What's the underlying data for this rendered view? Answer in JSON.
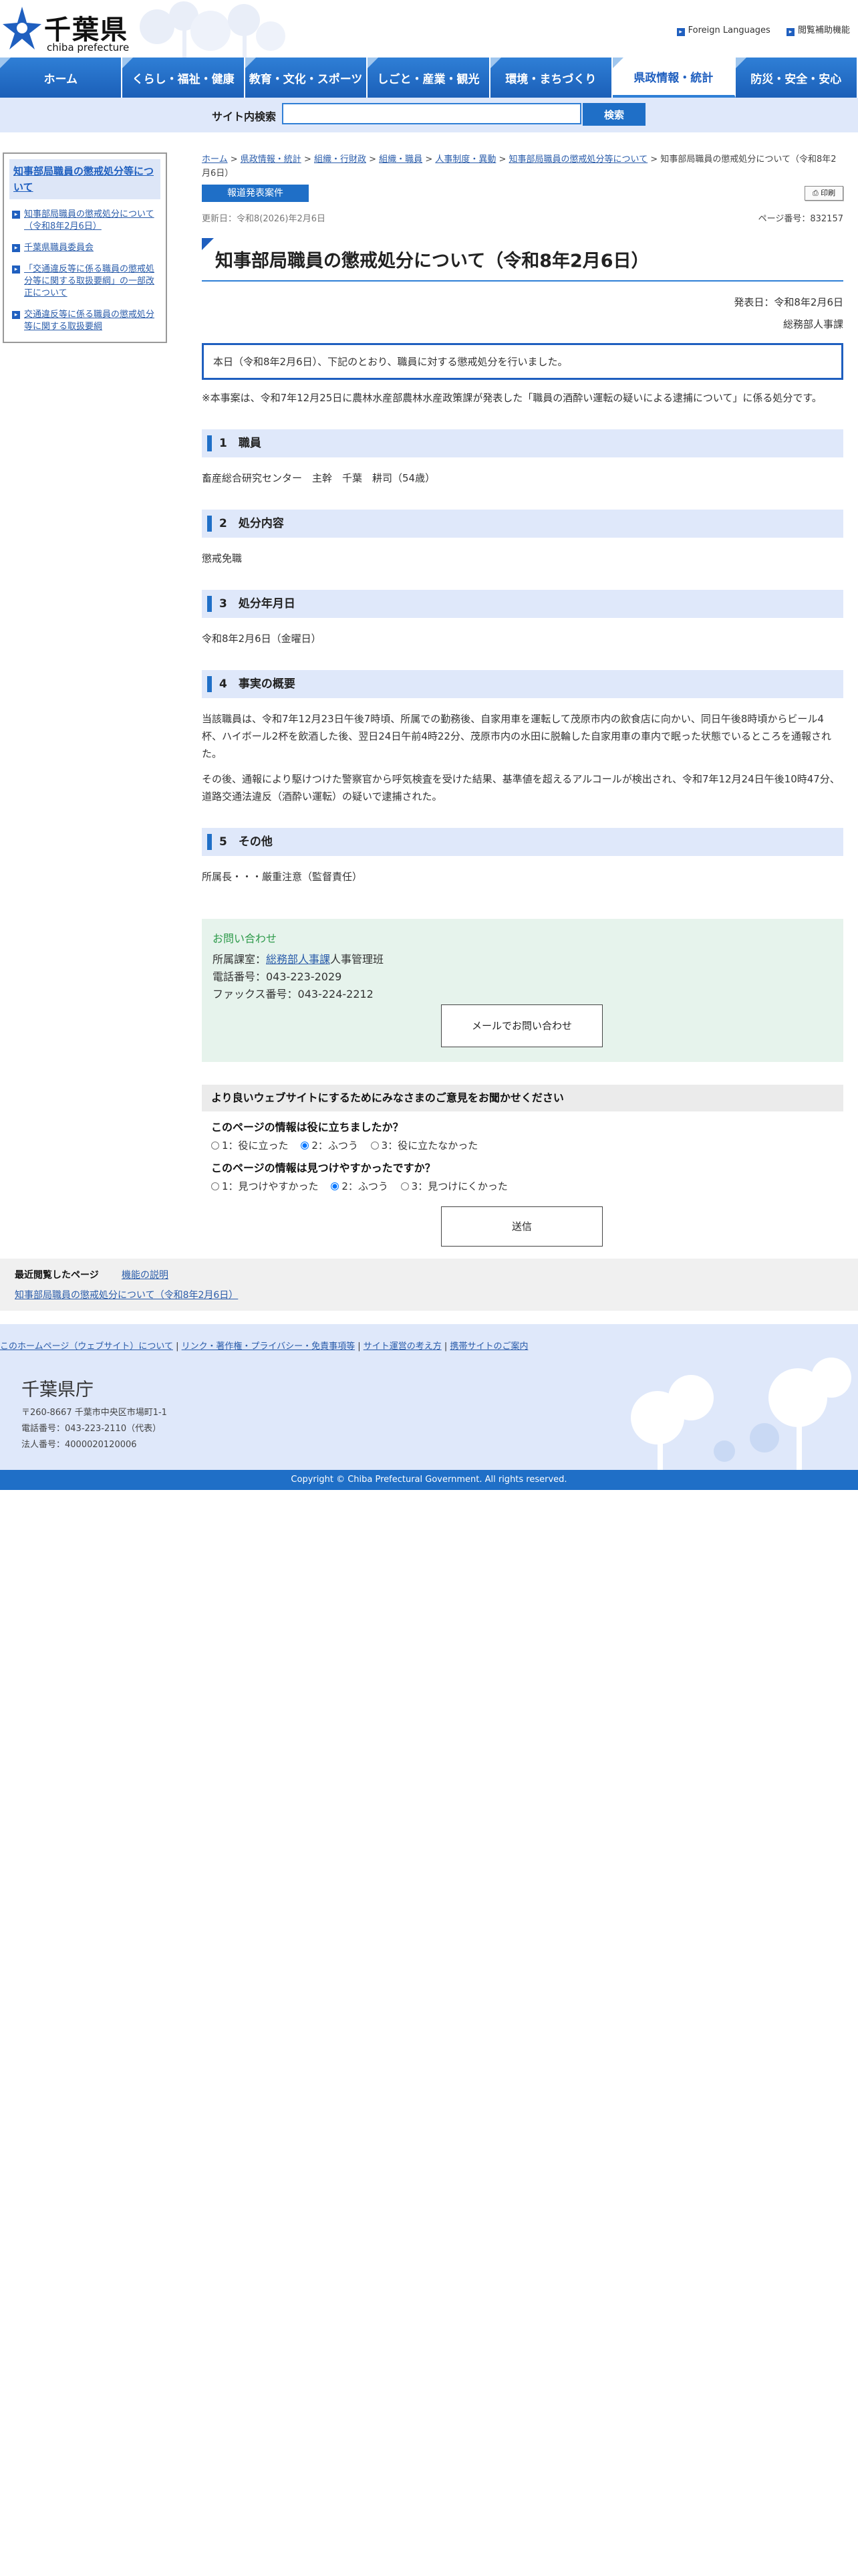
{
  "header": {
    "logo_jp": "千葉県",
    "logo_en": "chiba prefecture",
    "links": [
      "Foreign Languages",
      "閲覧補助機能"
    ]
  },
  "gnav": [
    "ホーム",
    "くらし・福祉・健康",
    "教育・文化・スポーツ",
    "しごと・産業・観光",
    "環境・まちづくり",
    "県政情報・統計",
    "防災・安全・安心"
  ],
  "search": {
    "label": "サイト内検索",
    "button": "検索",
    "placeholder": ""
  },
  "sidebar": {
    "title": "知事部局職員の懲戒処分等について",
    "links": [
      "知事部局職員の懲戒処分について（令和8年2月6日）",
      "千葉県職員委員会",
      "「交通違反等に係る職員の懲戒処分等に関する取扱要綱」の一部改正について",
      "交通違反等に係る職員の懲戒処分等に関する取扱要綱"
    ]
  },
  "breadcrumb": {
    "items": [
      "ホーム",
      "県政情報・統計",
      "組織・行財政",
      "組織・職員",
      "人事制度・異動",
      "知事部局職員の懲戒処分等について"
    ],
    "current": "知事部局職員の懲戒処分について（令和8年2月6日）"
  },
  "badge": "報道発表案件",
  "print": "印刷",
  "updated": "更新日：令和8(2026)年2月6日",
  "page_no": "ページ番号：832157",
  "title": "知事部局職員の懲戒処分について（令和8年2月6日）",
  "pub_date": "発表日：令和8年2月6日",
  "department": "総務部人事課",
  "announce": "本日（令和8年2月6日）、下記のとおり、職員に対する懲戒処分を行いました。",
  "note": "※本事案は、令和7年12月25日に農林水産部農林水産政策課が発表した「職員の酒酔い運転の疑いによる逮捕について」に係る処分です。",
  "sections": [
    {
      "heading": "1　職員",
      "body": [
        "畜産総合研究センター　主幹　千葉　耕司（54歳）"
      ]
    },
    {
      "heading": "2　処分内容",
      "body": [
        "懲戒免職"
      ]
    },
    {
      "heading": "3　処分年月日",
      "body": [
        "令和8年2月6日（金曜日）"
      ]
    },
    {
      "heading": "4　事実の概要",
      "body": [
        "当該職員は、令和7年12月23日午後7時頃、所属での勤務後、自家用車を運転して茂原市内の飲食店に向かい、同日午後8時頃からビール4杯、ハイボール2杯を飲酒した後、翌日24日午前4時22分、茂原市内の水田に脱輪した自家用車の車内で眠った状態でいるところを通報された。",
        "その後、通報により駆けつけた警察官から呼気検査を受けた結果、基準値を超えるアルコールが検出され、令和7年12月24日午後10時47分、道路交通法違反（酒酔い運転）の疑いで逮捕された。"
      ]
    },
    {
      "heading": "5　その他",
      "body": [
        "所属長・・・厳重注意（監督責任）"
      ]
    }
  ],
  "contact": {
    "title": "お問い合わせ",
    "dept_prefix": "所属課室：",
    "dept_link": "総務部人事課",
    "dept_suffix": "人事管理班",
    "tel": "電話番号：043-223-2029",
    "fax": "ファックス番号：043-224-2212",
    "mail_button": "メールでお問い合わせ"
  },
  "feedback": {
    "title": "より良いウェブサイトにするためにみなさまのご意見をお聞かせください",
    "q1": "このページの情報は役に立ちましたか？",
    "q1_options": [
      "1：役に立った",
      "2：ふつう",
      "3：役に立たなかった"
    ],
    "q2": "このページの情報は見つけやすかったですか？",
    "q2_options": [
      "1：見つけやすかった",
      "2：ふつう",
      "3：見つけにくかった"
    ],
    "selected": "2",
    "send": "送信"
  },
  "recent": {
    "label": "最近閲覧したページ",
    "help": "機能の説明",
    "item": "知事部局職員の懲戒処分について（令和8年2月6日）"
  },
  "footer": {
    "links": [
      "このホームページ（ウェブサイト）について",
      "リンク・著作権・プライバシー・免責事項等",
      "サイト運営の考え方",
      "携帯サイトのご案内"
    ],
    "office": "千葉県庁",
    "address": "〒260-8667 千葉市中央区市場町1-1",
    "tel": "電話番号：043-223-2110（代表）",
    "corp": "法人番号：4000020120006",
    "copyright": "Copyright © Chiba Prefectural Government. All rights reserved."
  },
  "colors": {
    "primary": "#1f6fc7",
    "nav_light": "#dfe8fa",
    "contact_bg": "#e6f3ec",
    "contact_title": "#2d9a4a"
  }
}
